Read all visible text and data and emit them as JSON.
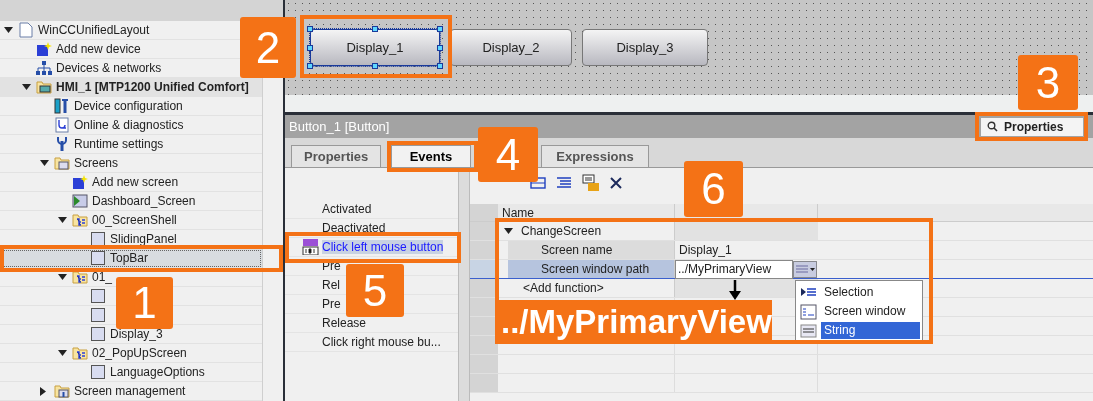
{
  "project_tree": [
    {
      "label": "WinCCUnifiedLayout",
      "kind": "project",
      "expanded": true,
      "selected": false,
      "children": [
        {
          "label": "Add new device",
          "kind": "add",
          "selected": false
        },
        {
          "label": "Devices & networks",
          "kind": "network",
          "selected": false
        },
        {
          "label": "HMI_1 [MTP1200 Unified Comfort]",
          "kind": "device",
          "expanded": true,
          "selected": false,
          "children": [
            {
              "label": "Device configuration",
              "kind": "config",
              "selected": false
            },
            {
              "label": "Online & diagnostics",
              "kind": "diag",
              "selected": false
            },
            {
              "label": "Runtime settings",
              "kind": "wrench",
              "selected": false
            },
            {
              "label": "Screens",
              "kind": "folder",
              "expanded": true,
              "selected": false,
              "children": [
                {
                  "label": "Add new screen",
                  "kind": "add",
                  "selected": false
                },
                {
                  "label": "Dashboard_Screen",
                  "kind": "start-screen",
                  "selected": false
                },
                {
                  "label": "00_ScreenShell",
                  "kind": "group",
                  "expanded": true,
                  "selected": false,
                  "children": [
                    {
                      "label": "SlidingPanel",
                      "kind": "screen",
                      "selected": false
                    },
                    {
                      "label": "TopBar",
                      "kind": "screen",
                      "selected": true
                    }
                  ]
                },
                {
                  "label": "01_",
                  "kind": "group",
                  "expanded": true,
                  "selected": false,
                  "children": [
                    {
                      "kind": "screen",
                      "selected": false
                    },
                    {
                      "kind": "screen",
                      "selected": false
                    },
                    {
                      "label": "Display_3",
                      "kind": "screen",
                      "selected": false
                    }
                  ]
                },
                {
                  "label": "02_PopUpScreen",
                  "kind": "group",
                  "expanded": true,
                  "selected": false,
                  "children": [
                    {
                      "label": "LanguageOptions",
                      "kind": "screen",
                      "selected": false
                    }
                  ]
                }
              ]
            },
            {
              "label": "Screen management",
              "kind": "tool-folder",
              "expanded": false,
              "selected": false
            }
          ]
        }
      ]
    }
  ],
  "canvas_buttons": [
    {
      "label": "Display_1",
      "selected": true
    },
    {
      "label": "Display_2",
      "selected": false
    },
    {
      "label": "Display_3",
      "selected": false
    }
  ],
  "inspector": {
    "title": "Button_1 [Button]",
    "properties_button": "Properties",
    "tabs": [
      {
        "label": "Properties",
        "selected": false
      },
      {
        "label": "Events",
        "selected": true
      },
      {
        "label": "Expressions",
        "selected": false
      }
    ],
    "events": [
      {
        "label": "Activated",
        "selected": false
      },
      {
        "label": "Deactivated",
        "selected": false
      },
      {
        "label": "Click left mouse button",
        "selected": true
      },
      {
        "label": "Pre",
        "selected": false
      },
      {
        "label": "Rel",
        "selected": false
      },
      {
        "label": "Pre",
        "selected": false
      },
      {
        "label": "Release",
        "selected": false
      },
      {
        "label": "Click right mouse bu...",
        "selected": false
      }
    ],
    "table": {
      "columns": [
        "Name"
      ],
      "function": "ChangeScreen",
      "expanded": true,
      "params": [
        {
          "name": "Screen name",
          "value": "Display_1",
          "selected": false
        },
        {
          "name": "Screen window path",
          "value": "../MyPrimaryView",
          "selected": true
        }
      ],
      "add_function": "<Add function>"
    },
    "dropdown": [
      {
        "label": "Selection",
        "kind": "selection",
        "selected": false
      },
      {
        "label": "Screen window",
        "kind": "window",
        "selected": false
      },
      {
        "label": "String",
        "kind": "string",
        "selected": true
      }
    ]
  },
  "callouts": [
    {
      "number": "1"
    },
    {
      "number": "2"
    },
    {
      "number": "3"
    },
    {
      "number": "4"
    },
    {
      "number": "5"
    },
    {
      "number": "6"
    }
  ],
  "callout_label": "../MyPrimaryView"
}
